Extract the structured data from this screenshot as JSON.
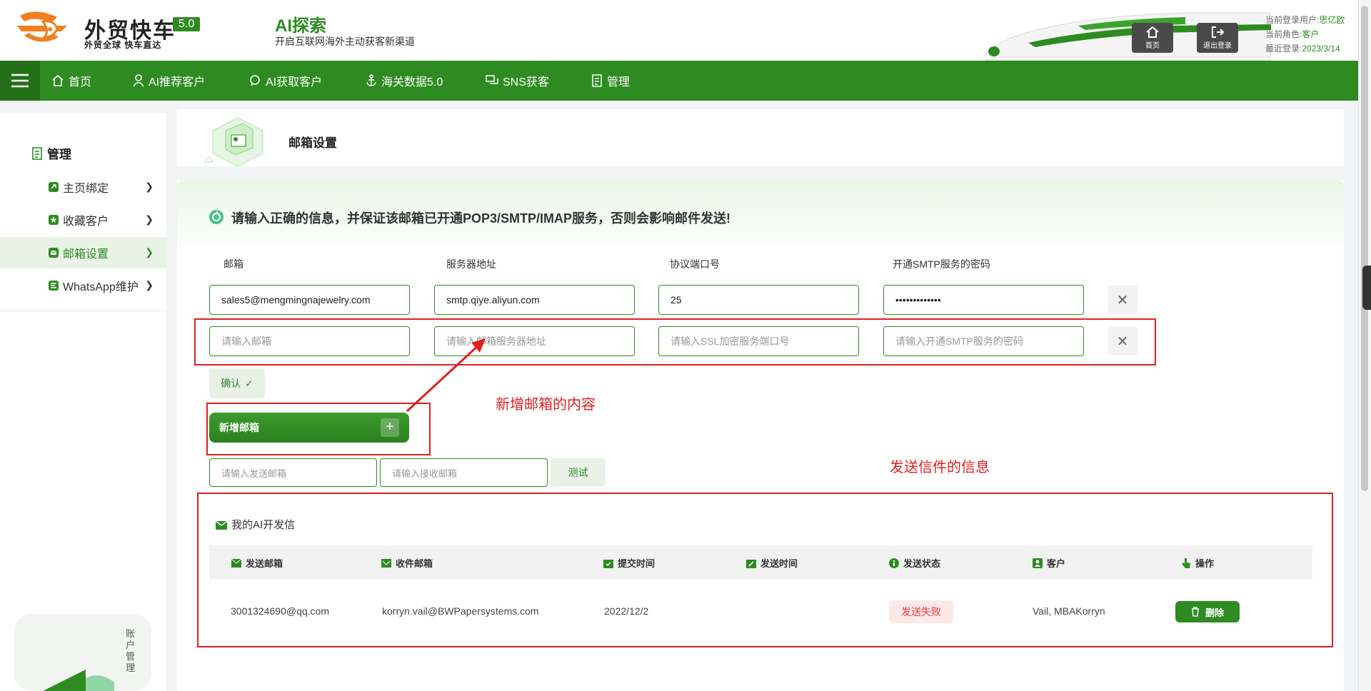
{
  "header": {
    "brand_name": "外贸快车",
    "version": "5.0",
    "brand_sub": "外贸全球 快车直达",
    "ai_title": "AI探索",
    "ai_sub": "开启互联网海外主动获客新渠道",
    "home_label": "首页",
    "logout_label": "退出登录",
    "user_label": "当前登录用户:",
    "user_value": "思亿欧",
    "role_label": "当前角色:",
    "role_value": "客户",
    "last_login_label": "最近登录:",
    "last_login_value": "2023/3/14"
  },
  "nav": {
    "items": [
      "首页",
      "AI推荐客户",
      "AI获取客户",
      "海关数据5.0",
      "SNS获客",
      "管理"
    ]
  },
  "sidebar": {
    "title": "管理",
    "items": [
      {
        "label": "主页绑定"
      },
      {
        "label": "收藏客户"
      },
      {
        "label": "邮箱设置"
      },
      {
        "label": "WhatsApp维护"
      }
    ],
    "account_text": "账户管理"
  },
  "page": {
    "title": "邮箱设置",
    "notice": "请输入正确的信息，并保证该邮箱已开通POP3/SMTP/IMAP服务，否则会影响邮件发送!"
  },
  "form": {
    "labels": [
      "邮箱",
      "服务器地址",
      "协议端口号",
      "开通SMTP服务的密码"
    ],
    "row1": {
      "email": "sales5@mengmingnajewelry.com",
      "server": "smtp.qiye.aliyun.com",
      "port": "25",
      "password": "•••••••••••••"
    },
    "row2_placeholders": {
      "email": "请输入邮箱",
      "server": "请输入邮箱服务器地址",
      "port": "请输入SSL加密服务端口号",
      "password": "请输入开通SMTP服务的密码"
    },
    "confirm_label": "确认",
    "add_label": "新增邮箱",
    "send_placeholder": "请输入发送邮箱",
    "recv_placeholder": "请输入接收邮箱",
    "test_label": "测试"
  },
  "annotations": {
    "new_mail": "新增邮箱的内容",
    "send_info": "发送信件的信息"
  },
  "mail_list": {
    "title": "我的AI开发信",
    "columns": [
      "发送邮箱",
      "收件邮箱",
      "提交时间",
      "发送时间",
      "发送状态",
      "客户",
      "操作"
    ],
    "rows": [
      {
        "sender": "3001324690@qq.com",
        "recipient": "korryn.vail@BWPapersystems.com",
        "submitted": "2022/12/2",
        "sent": "",
        "status": "发送失败",
        "customer": "Vail, MBAKorryn",
        "action": "删除"
      }
    ]
  },
  "colors": {
    "primary": "#2e8b22",
    "annotation": "#e02020",
    "status_fail": "#e03c3c"
  }
}
